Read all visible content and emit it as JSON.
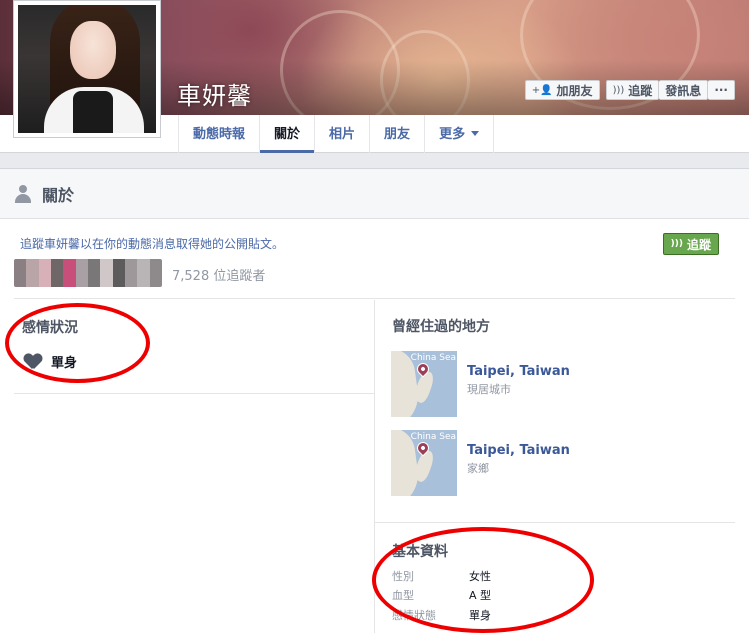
{
  "profile": {
    "name": "車妍馨"
  },
  "cover_actions": {
    "add_friend": "加朋友",
    "follow": "追蹤",
    "message": "發訊息",
    "more": "···"
  },
  "tabs": [
    {
      "label": "動態時報",
      "active": false
    },
    {
      "label": "關於",
      "active": true
    },
    {
      "label": "相片",
      "active": false
    },
    {
      "label": "朋友",
      "active": false
    },
    {
      "label": "更多",
      "active": false,
      "dropdown": true
    }
  ],
  "about": {
    "title": "關於",
    "follow_prompt": "追蹤車妍馨以在你的動態消息取得她的公開貼文。",
    "follower_count": "7,528 位追蹤者",
    "follow_button": "追蹤",
    "relationship": {
      "title": "感情狀況",
      "status": "單身"
    },
    "places": {
      "title": "曾經住過的地方",
      "items": [
        {
          "name": "Taipei, Taiwan",
          "type": "現居城市",
          "map_label": "China Sea"
        },
        {
          "name": "Taipei, Taiwan",
          "type": "家鄉",
          "map_label": "China Sea"
        }
      ]
    },
    "basic_info": {
      "title": "基本資料",
      "rows": [
        {
          "label": "性別",
          "value": "女性"
        },
        {
          "label": "血型",
          "value": "A 型"
        },
        {
          "label": "感情狀態",
          "value": "單身"
        }
      ]
    }
  },
  "colors": {
    "link": "#3b5998",
    "follow_green": "#69a74e",
    "annotation_red": "#ee0000",
    "page_bg": "#e9eaed"
  },
  "icons": {
    "add_friend": "add-friend-icon",
    "follow": "rss-icon",
    "about": "person-icon",
    "relationship": "heart-icon",
    "map_pin": "map-pin-icon",
    "more_caret": "chevron-down-icon"
  }
}
